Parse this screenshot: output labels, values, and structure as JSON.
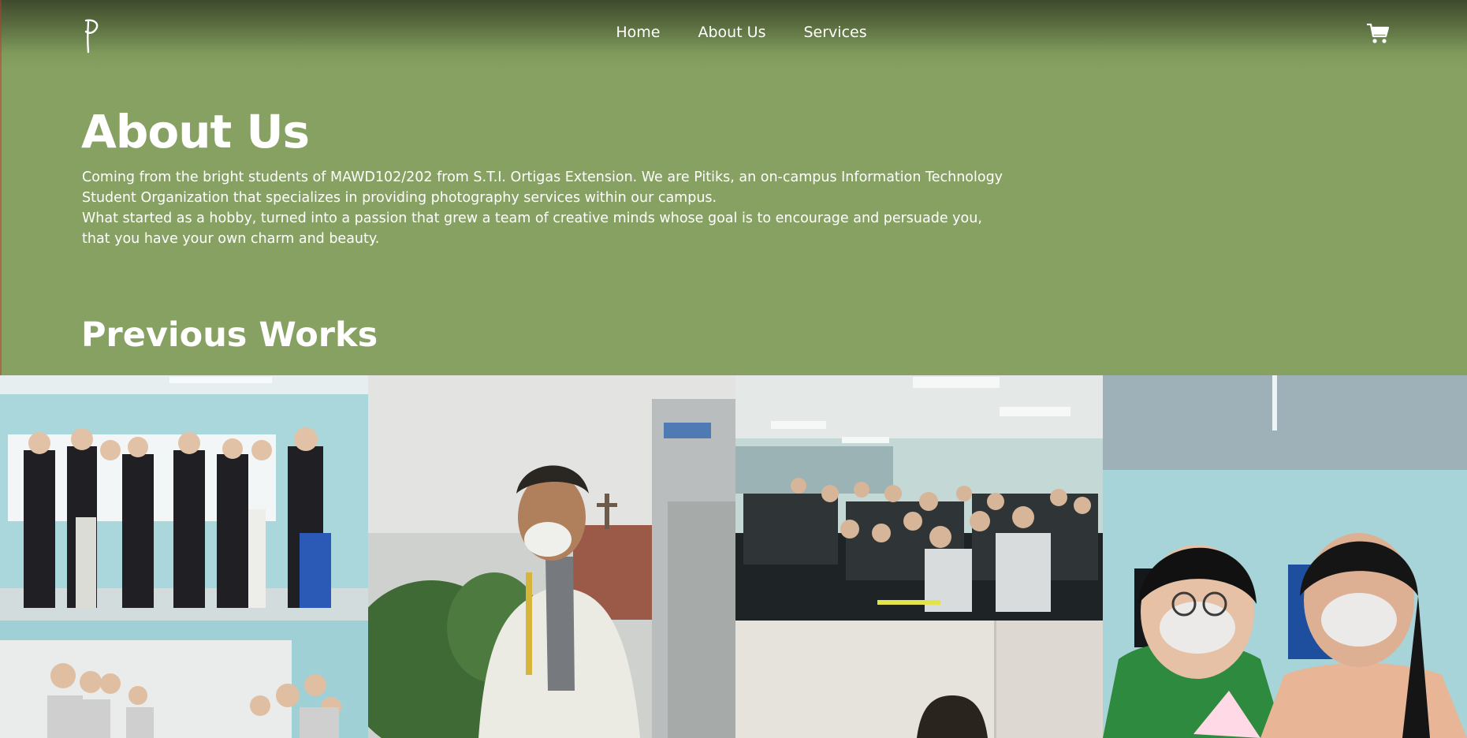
{
  "nav": {
    "logo_alt": "P",
    "items": [
      "Home",
      "About Us",
      "Services"
    ],
    "cart_icon": "shopping-cart-icon"
  },
  "about": {
    "title": "About Us",
    "paragraph1": "Coming from the bright students of MAWD102/202 from S.T.I. Ortigas Extension. We are Pitiks, an on-campus Information Technology Student Organization that specializes in providing photography services within our campus.",
    "paragraph2": "What started as a hobby, turned into a passion that grew a team of creative minds whose goal is to encourage and persuade you, that you have your own charm and beauty."
  },
  "previous_works": {
    "title": "Previous Works",
    "photos": [
      {
        "name": "photo-group-blazers"
      },
      {
        "name": "photo-student-outdoor"
      },
      {
        "name": "photo-classroom-crowd"
      },
      {
        "name": "photo-two-girls-peace-sign"
      },
      {
        "name": "photo-group-classroom"
      },
      {
        "name": "photo-girl-portrait"
      }
    ]
  },
  "colors": {
    "background": "#87a163",
    "header_dark": "#3f4a2d",
    "text": "#ffffff"
  }
}
